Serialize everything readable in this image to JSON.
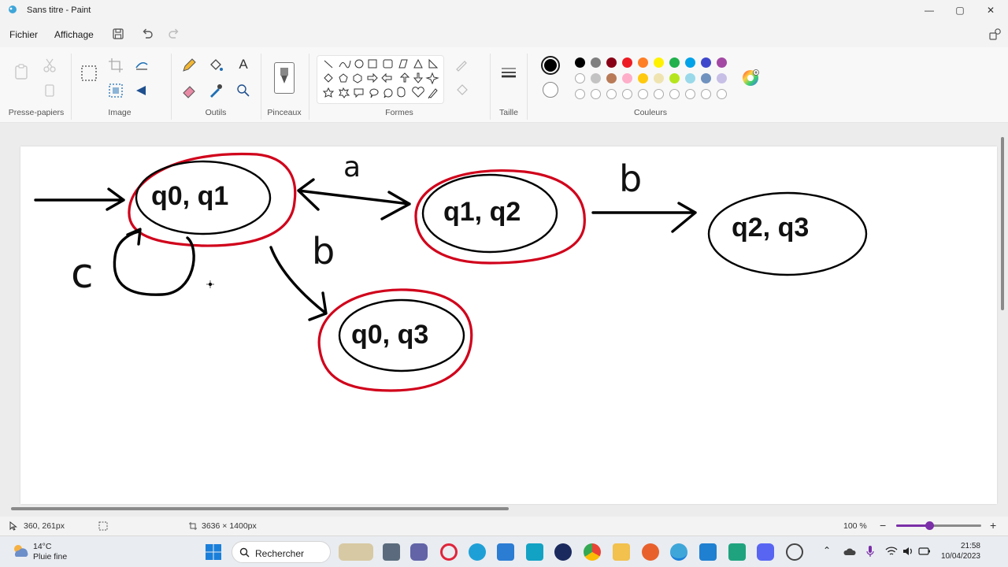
{
  "titlebar": {
    "title": "Sans titre - Paint",
    "minimize": "—",
    "maximize": "▢",
    "close": "✕"
  },
  "menu": {
    "file": "Fichier",
    "view": "Affichage"
  },
  "ribbon": {
    "groups": {
      "clipboard": "Presse-papiers",
      "image": "Image",
      "tools": "Outils",
      "brushes": "Pinceaux",
      "shapes": "Formes",
      "size": "Taille",
      "colors": "Couleurs"
    },
    "text_tool": "A",
    "primary_color": "#000000",
    "secondary_color": "#ffffff",
    "palette_row1": [
      "#000000",
      "#7f7f7f",
      "#880015",
      "#ed1c24",
      "#ff7f27",
      "#fff200",
      "#22b14c",
      "#00a2e8",
      "#3f48cc",
      "#a349a4"
    ],
    "palette_row2": [
      "#ffffff",
      "#c3c3c3",
      "#b97a57",
      "#ffaec9",
      "#ffc90e",
      "#efe4b0",
      "#b5e61d",
      "#99d9ea",
      "#7092be",
      "#c8bfe7"
    ]
  },
  "diagram": {
    "nodes": [
      {
        "label": "q0, q1",
        "accepting": true
      },
      {
        "label": "q1, q2",
        "accepting": true
      },
      {
        "label": "q2, q3",
        "accepting": false
      },
      {
        "label": "q0, q3",
        "accepting": true
      }
    ],
    "edge_labels": {
      "a": "a",
      "b_right": "b",
      "b_down": "b",
      "c": "c"
    },
    "ink_color": "#000000",
    "accept_color": "#d0021b"
  },
  "status": {
    "cursor": "360, 261px",
    "canvas_size": "3636 × 1400px",
    "zoom": "100 %"
  },
  "taskbar": {
    "weather_temp": "14°C",
    "weather_desc": "Pluie fine",
    "search": "Rechercher",
    "time": "21:58",
    "date": "10/04/2023"
  }
}
